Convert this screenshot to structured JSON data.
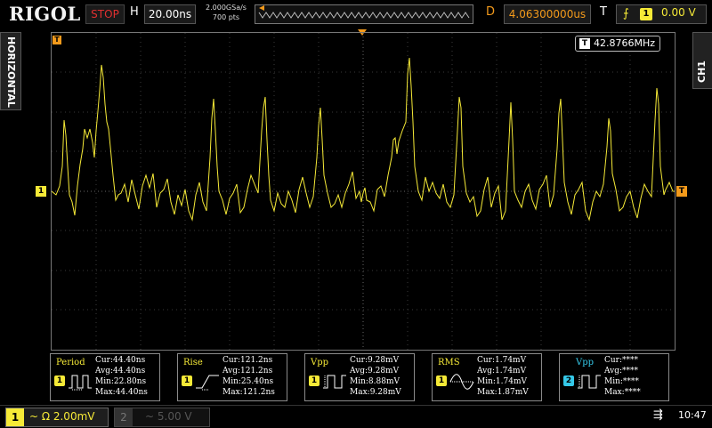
{
  "header": {
    "logo": "RIGOL",
    "run_state": "STOP",
    "horizontal_label": "H",
    "timebase": "20.00ns",
    "sample_rate": "2.000GSa/s",
    "memory_depth": "700  pts",
    "delay_label": "D",
    "delay": "4.06300000us",
    "trigger_label": "T",
    "trigger_channel": "1",
    "trigger_level": "0.00 V"
  },
  "side_tabs": {
    "left": "HORIZONTAL",
    "right": "CH1"
  },
  "screen": {
    "frequency_badge": "T",
    "frequency": "42.8766MHz",
    "channel_marker": "1",
    "trigger_marker": "T",
    "waveform_color": "#f6ea37",
    "trigger_color": "#f39a1b"
  },
  "measurements": [
    {
      "name": "Period",
      "channel": "1",
      "icon": "period-icon",
      "cur": "Cur:44.40ns",
      "avg": "Avg:44.40ns",
      "min": "Min:22.80ns",
      "max": "Max:44.40ns"
    },
    {
      "name": "Rise",
      "channel": "1",
      "icon": "rise-icon",
      "cur": "Cur:121.2ns",
      "avg": "Avg:121.2ns",
      "min": "Min:25.40ns",
      "max": "Max:121.2ns"
    },
    {
      "name": "Vpp",
      "channel": "1",
      "icon": "vpp-icon",
      "cur": "Cur:9.28mV",
      "avg": "Avg:9.28mV",
      "min": "Min:8.88mV",
      "max": "Max:9.28mV"
    },
    {
      "name": "RMS",
      "channel": "1",
      "icon": "rms-icon",
      "cur": "Cur:1.74mV",
      "avg": "Avg:1.74mV",
      "min": "Min:1.74mV",
      "max": "Max:1.87mV"
    },
    {
      "name": "Vpp",
      "channel": "2",
      "icon": "vpp-icon",
      "cur": "Cur:****",
      "avg": "Avg:****",
      "min": "Min:****",
      "max": "Max:****"
    }
  ],
  "footer": {
    "ch1_number": "1",
    "ch1_coupling": "~ Ω  2.00mV",
    "ch2_number": "2",
    "ch2_coupling": "~  5.00 V",
    "time": "10:47"
  }
}
